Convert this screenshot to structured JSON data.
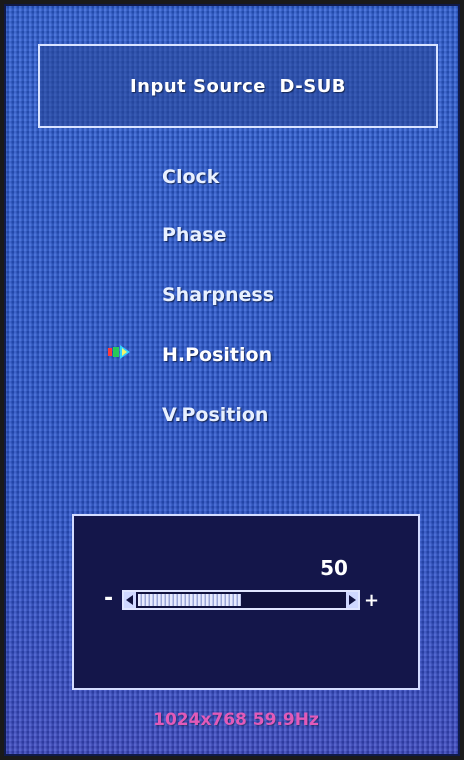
{
  "header": {
    "title": "Input Source  D-SUB"
  },
  "menu": {
    "items": [
      {
        "label": "Clock"
      },
      {
        "label": "Phase"
      },
      {
        "label": "Sharpness"
      },
      {
        "label": "H.Position"
      },
      {
        "label": "V.Position"
      }
    ],
    "selected": "H.Position",
    "cursor_icon": "arrow-cursor-icon"
  },
  "slider": {
    "value": "50",
    "level_percent": 50,
    "minus_label": "-",
    "plus_label": "+"
  },
  "status": {
    "resolution": "1024x768 59.9Hz"
  },
  "colors": {
    "background": "#2b57d1",
    "panel": "#14164a",
    "status_text": "#e25ab8",
    "text": "#ffffff"
  }
}
